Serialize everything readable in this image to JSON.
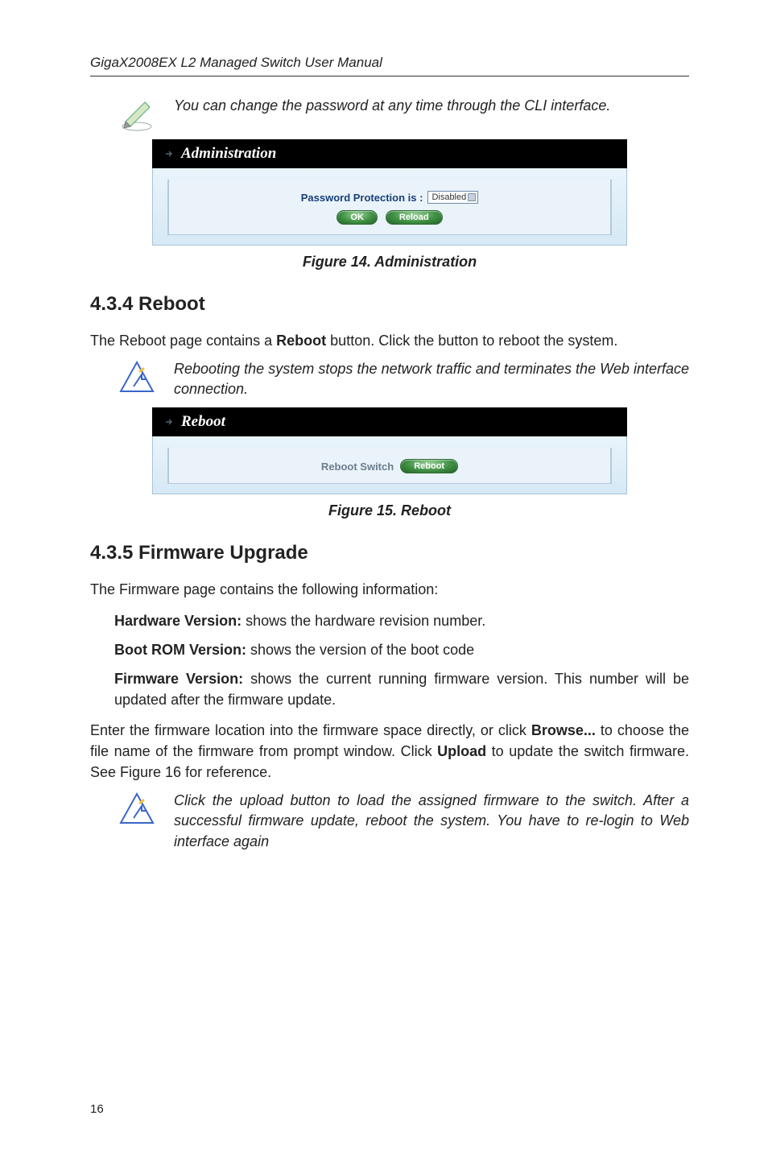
{
  "header": {
    "title": "GigaX2008EX L2 Managed Switch User Manual"
  },
  "note1": {
    "icon": "pencil-note-icon",
    "text": "You can change the password at any time through the CLI interface."
  },
  "figure14": {
    "titlebar": "Administration",
    "row_label": "Password Protection is :",
    "select_value": "Disabled",
    "btn_ok": "OK",
    "btn_reload": "Reload",
    "caption": "Figure 14. Administration"
  },
  "section434": {
    "heading": "4.3.4  Reboot",
    "para1_a": "The Reboot page contains a ",
    "para1_b": "Reboot",
    "para1_c": " button. Click the button to reboot the system."
  },
  "note2": {
    "icon": "alert-icon",
    "text": "Rebooting the system stops the network traffic and terminates the Web interface connection."
  },
  "figure15": {
    "titlebar": "Reboot",
    "row_label": "Reboot Switch",
    "btn_reboot": "Reboot",
    "caption": "Figure 15. Reboot"
  },
  "section435": {
    "heading": "4.3.5  Firmware Upgrade",
    "intro": "The Firmware page contains the following information:",
    "hw_label": "Hardware Version:",
    "hw_text": " shows the hardware revision number.",
    "boot_label": "Boot ROM Version:",
    "boot_text": " shows the version of the boot code",
    "fw_label": "Firmware Version:",
    "fw_text": " shows the current running firmware version. This number will be updated after the firmware update.",
    "para2_a": "Enter the firmware location into the firmware space directly, or click ",
    "para2_b": "Browse...",
    "para2_c": " to choose the file name of the firmware from prompt window. Click ",
    "para2_d": "Upload",
    "para2_e": " to update the switch firmware. See Figure 16 for reference."
  },
  "note3": {
    "icon": "alert-icon",
    "text": "Click the upload button to load the assigned firmware to the switch. After a successful firmware update, reboot the system. You have to re-login to Web interface again"
  },
  "footer": {
    "page": "16"
  }
}
